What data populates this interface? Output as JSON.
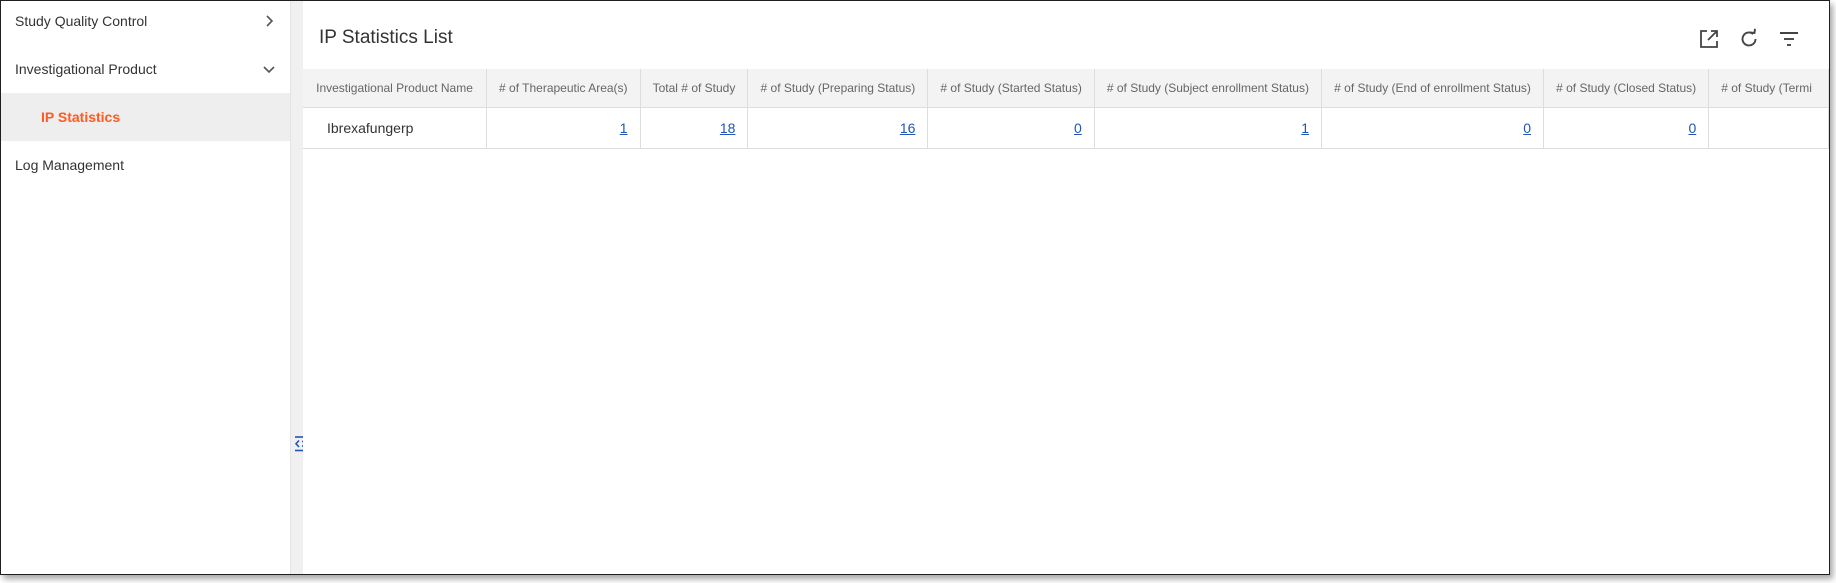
{
  "sidebar": {
    "items": [
      {
        "label": "Study Quality Control",
        "chevron": "chevron-right-icon"
      },
      {
        "label": "Investigational Product",
        "chevron": "chevron-down-icon"
      },
      {
        "label": "IP Statistics",
        "active": true
      },
      {
        "label": "Log Management"
      }
    ]
  },
  "main": {
    "title": "IP Statistics List",
    "toolbar": {
      "export_icon": "open-in-new-icon",
      "refresh_icon": "refresh-icon",
      "filter_icon": "filter-icon"
    }
  },
  "table": {
    "columns": [
      "Investigational Product Name",
      "# of Therapeutic Area(s)",
      "Total # of Study",
      "# of Study (Preparing Status)",
      "# of Study (Started Status)",
      "# of Study (Subject enrollment Status)",
      "# of Study (End of enrollment Status)",
      "# of Study (Closed Status)",
      "# of Study (Termi"
    ],
    "rows": [
      {
        "name": "Ibrexafungerp",
        "therapeutic_areas": "1",
        "total_study": "18",
        "preparing": "16",
        "started": "0",
        "subject_enrollment": "1",
        "end_of_enrollment": "0",
        "closed": "0",
        "terminated": ""
      }
    ]
  },
  "colors": {
    "accent": "#ff5a1f",
    "link": "#2155b8",
    "header_bg": "#f3f3f3",
    "active_bg": "#eeeeee"
  }
}
